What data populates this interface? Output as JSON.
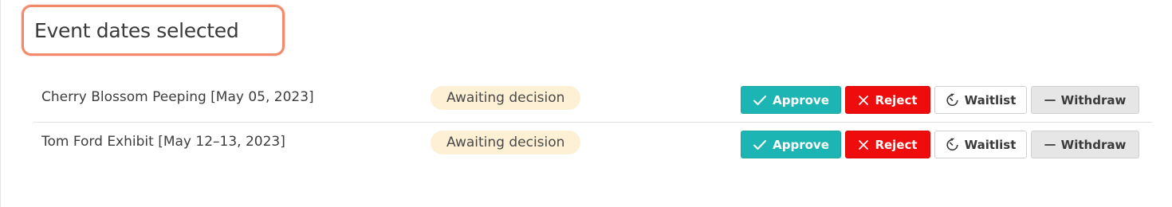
{
  "section": {
    "title": "Event dates selected"
  },
  "rows": [
    {
      "event": "Cherry Blossom Peeping [May 05, 2023]",
      "status": "Awaiting decision"
    },
    {
      "event": "Tom Ford Exhibit [May 12–13, 2023]",
      "status": "Awaiting decision"
    }
  ],
  "actions": {
    "approve": "Approve",
    "reject": "Reject",
    "waitlist": "Waitlist",
    "withdraw": "Withdraw"
  },
  "icons": {
    "approve": "check-icon",
    "reject": "x-icon",
    "waitlist": "timer-icon",
    "withdraw": "dash-icon"
  },
  "colors": {
    "approve": "#1db5b3",
    "reject": "#ee0c0c",
    "status_badge_bg": "#fdf0d5",
    "title_outline": "#f2896a"
  }
}
